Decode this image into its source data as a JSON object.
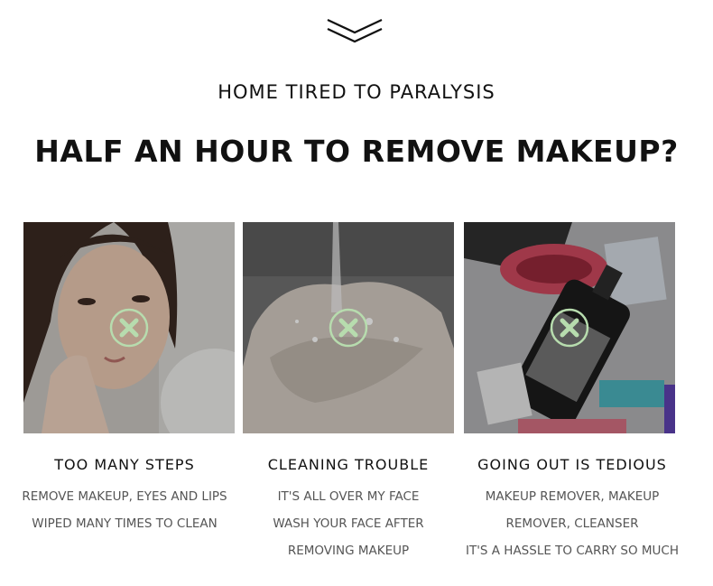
{
  "header": {
    "scroll_indicator_icon": "double-chevron-down-icon",
    "kicker": "HOME TIRED TO PARALYSIS",
    "headline": "HALF AN HOUR TO REMOVE MAKEUP?"
  },
  "colors": {
    "accent_x": "#b7dcae",
    "overlay": "#000000",
    "text_primary": "#111111",
    "text_secondary": "#555555"
  },
  "cards": [
    {
      "icon": "x-circle-icon",
      "photo": "woman touching face",
      "title": "TOO MANY STEPS",
      "lines": [
        "REMOVE MAKEUP, EYES AND LIPS",
        "WIPED MANY TIMES TO CLEAN"
      ]
    },
    {
      "icon": "x-circle-icon",
      "photo": "hands under running water",
      "title": "CLEANING TROUBLE",
      "lines": [
        "IT'S ALL OVER MY FACE",
        "WASH YOUR FACE AFTER",
        "REMOVING MAKEUP"
      ]
    },
    {
      "icon": "x-circle-icon",
      "photo": "cosmetics and bottles",
      "title": "GOING OUT IS TEDIOUS",
      "lines": [
        "MAKEUP REMOVER, MAKEUP",
        "REMOVER, CLEANSER",
        "IT'S A HASSLE TO CARRY SO MUCH"
      ]
    }
  ]
}
